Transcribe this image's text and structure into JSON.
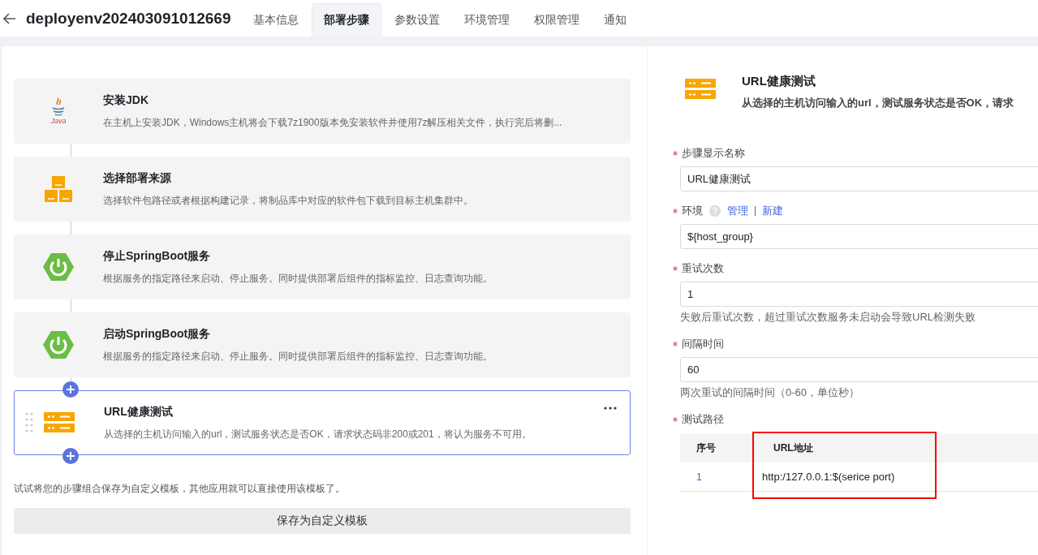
{
  "header": {
    "title": "deployenv202403091012669"
  },
  "tabs": [
    {
      "label": "基本信息",
      "selected": false
    },
    {
      "label": "部署步骤",
      "selected": true
    },
    {
      "label": "参数设置",
      "selected": false
    },
    {
      "label": "环境管理",
      "selected": false
    },
    {
      "label": "权限管理",
      "selected": false
    },
    {
      "label": "通知",
      "selected": false
    }
  ],
  "steps": [
    {
      "kind": "java",
      "icon_caption": "Java",
      "title": "安装JDK",
      "description": "在主机上安装JDK，Windows主机将会下载7z1900版本免安装软件并使用7z解压相关文件，执行完后将删...",
      "selected": false
    },
    {
      "kind": "boxes",
      "title": "选择部署来源",
      "description": "选择软件包路径或者根据构建记录，将制品库中对应的软件包下载到目标主机集群中。",
      "selected": false
    },
    {
      "kind": "power",
      "title": "停止SpringBoot服务",
      "description": "根据服务的指定路径来启动、停止服务。同时提供部署后组件的指标监控、日志查询功能。",
      "selected": false
    },
    {
      "kind": "power",
      "title": "启动SpringBoot服务",
      "description": "根据服务的指定路径来启动、停止服务。同时提供部署后组件的指标监控、日志查询功能。",
      "selected": false
    },
    {
      "kind": "server",
      "title": "URL健康测试",
      "description": "从选择的主机访问输入的url，测试服务状态是否OK，请求状态码非200或201，将认为服务不可用。",
      "selected": true
    }
  ],
  "template_hint": "试试将您的步骤组合保存为自定义模板，其他应用就可以直接使用该模板了。",
  "save_template_button": "保存为自定义模板",
  "detail": {
    "kind": "server",
    "title": "URL健康测试",
    "description": "从选择的主机访问输入的url，测试服务状态是否OK，请求",
    "fields": [
      {
        "kind": "input",
        "label": "步骤显示名称",
        "required": true,
        "value": "URL健康测试"
      },
      {
        "kind": "input",
        "label": "环境",
        "required": true,
        "help_icon": true,
        "links": [
          "管理",
          "新建"
        ],
        "value": "${host_group}"
      },
      {
        "kind": "input",
        "label": "重试次数",
        "required": true,
        "value": "1",
        "hint": "失败后重试次数，超过重试次数服务未启动会导致URL检测失败"
      },
      {
        "kind": "input",
        "label": "间隔时间",
        "required": true,
        "value": "60",
        "hint": "两次重试的间隔时间（0-60，单位秒）"
      },
      {
        "kind": "table",
        "label": "测试路径",
        "required": true,
        "columns": [
          {
            "label": "序号"
          },
          {
            "label": "URL地址",
            "highlighted": true
          }
        ],
        "rows": [
          [
            "1",
            "http:/127.0.0.1:$(serice port)"
          ]
        ]
      }
    ]
  }
}
